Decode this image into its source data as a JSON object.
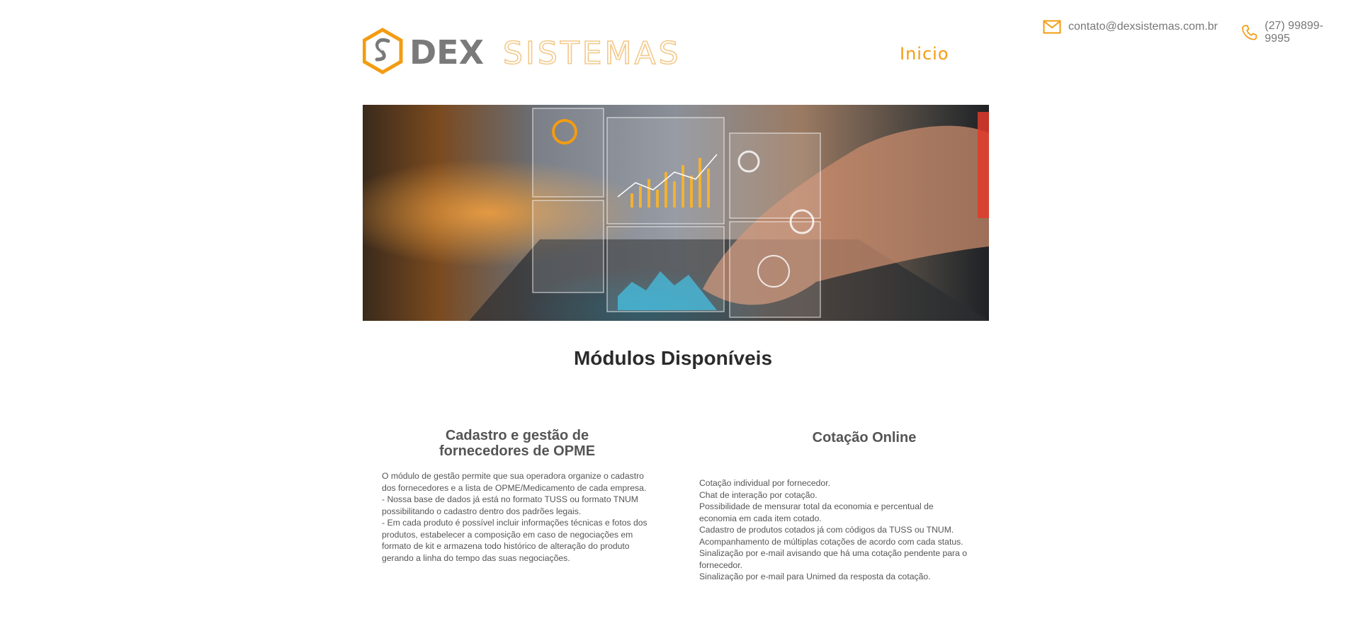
{
  "header": {
    "logo_text_primary": "DEX",
    "logo_text_secondary": "SISTEMAS",
    "nav": {
      "inicio": "Inicio"
    },
    "contact": {
      "email": "contato@dexsistemas.com.br",
      "phone": "(27) 99899-9995"
    }
  },
  "hero": {
    "icon": "dashboard-hologram-image"
  },
  "section": {
    "title": "Módulos Disponíveis"
  },
  "modules": [
    {
      "title_lines": [
        "Cadastro e gestão de",
        "fornecedores de OPME"
      ],
      "lines": [
        "O módulo de gestão permite que sua operadora organize o cadastro",
        "dos fornecedores e a lista de OPME/Medicamento de cada empresa.",
        "- Nossa base de dados já está no formato TUSS ou formato TNUM",
        "possibilitando o cadastro dentro dos padrões legais.",
        "- Em cada produto é possível incluir informações técnicas e fotos dos",
        "produtos, estabelecer a composição em caso de negociações em",
        "formato de kit e armazena todo histórico de alteração do produto",
        "gerando a linha do tempo das suas negociações."
      ]
    },
    {
      "title_lines": [
        "Cotação Online"
      ],
      "lines": [
        "Cotação individual por fornecedor.",
        "Chat de interação por cotação.",
        "Possibilidade de mensurar total da economia e percentual de",
        "economia em cada item cotado.",
        "Cadastro de produtos cotados já com códigos da TUSS ou TNUM.",
        "Acompanhamento de múltiplas cotações de acordo com cada status.",
        "Sinalização por e-mail avisando que há uma cotação pendente para o",
        "fornecedor.",
        "Sinalização por e-mail para Unimed da resposta da cotação."
      ]
    }
  ],
  "colors": {
    "accent": "#f39c12",
    "logo_gray": "#7a7a7a",
    "text": "#555555"
  }
}
